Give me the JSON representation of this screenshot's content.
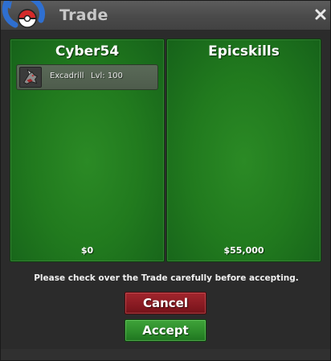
{
  "window": {
    "title": "Trade",
    "close_icon": "close-icon"
  },
  "panels": [
    {
      "player": "Cyber54",
      "money": "$0",
      "items": [
        {
          "icon": "excadrill-sprite-icon",
          "name": "Excadrill",
          "level": "Lvl: 100"
        }
      ]
    },
    {
      "player": "Epicskills",
      "money": "$55,000",
      "items": []
    }
  ],
  "notice": "Please check over the Trade carefully before accepting.",
  "buttons": {
    "cancel": "Cancel",
    "accept": "Accept"
  },
  "colors": {
    "panel_green": "#217a1e",
    "cancel_red": "#871a22",
    "accept_green": "#2c8a2a",
    "titlebar": "#4a4a4a"
  }
}
